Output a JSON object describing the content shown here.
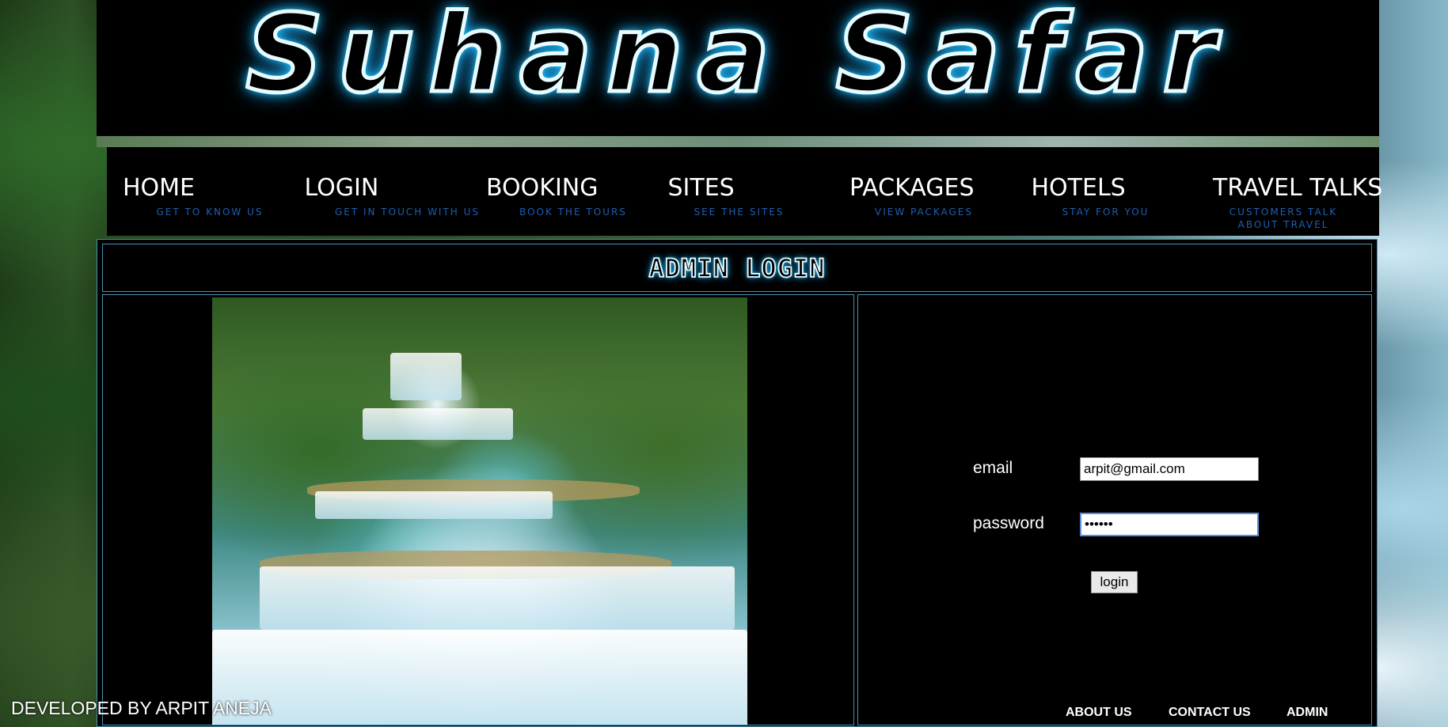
{
  "banner": {
    "title": "Suhana Safar"
  },
  "nav": {
    "items": [
      {
        "label": "HOME",
        "sub": "GET TO KNOW US"
      },
      {
        "label": "LOGIN",
        "sub": "GET IN TOUCH WITH US"
      },
      {
        "label": "BOOKING",
        "sub": "BOOK THE TOURS"
      },
      {
        "label": "SITES",
        "sub": "SEE THE SITES"
      },
      {
        "label": "PACKAGES",
        "sub": "VIEW PACKAGES"
      },
      {
        "label": "HOTELS",
        "sub": "STAY FOR YOU"
      },
      {
        "label": "TRAVEL TALKS",
        "sub": "CUSTOMERS TALK ABOUT TRAVEL"
      }
    ]
  },
  "page": {
    "title": "ADMIN LOGIN"
  },
  "form": {
    "email_label": "email",
    "email_value": "arpit@gmail.com",
    "password_label": "password",
    "password_value": "••••••",
    "login_label": "login"
  },
  "footer": {
    "links": [
      "ABOUT US",
      "CONTACT US",
      "ADMIN"
    ],
    "credit": "DEVELOPED BY ARPIT ANEJA"
  }
}
